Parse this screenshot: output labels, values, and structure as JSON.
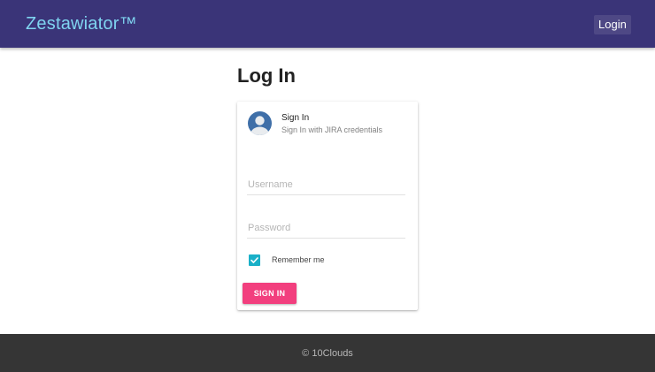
{
  "header": {
    "brand": "Zestawiator™",
    "login_link": "Login",
    "background_color": "#3a3478",
    "brand_color": "#7fd4f0"
  },
  "main": {
    "title": "Log In",
    "card": {
      "avatar_icon": "user-avatar-icon",
      "title": "Sign In",
      "subtitle": "Sign In with JIRA credentials",
      "username": {
        "value": "",
        "placeholder": "Username"
      },
      "password": {
        "value": "",
        "placeholder": "Password"
      },
      "remember_me": {
        "label": "Remember me",
        "checked": true
      },
      "sign_in_button": "SIGN IN",
      "accent_color": "#f23f7e",
      "checkbox_color": "#1ab0c8"
    }
  },
  "footer": {
    "text": "© 10Clouds"
  }
}
